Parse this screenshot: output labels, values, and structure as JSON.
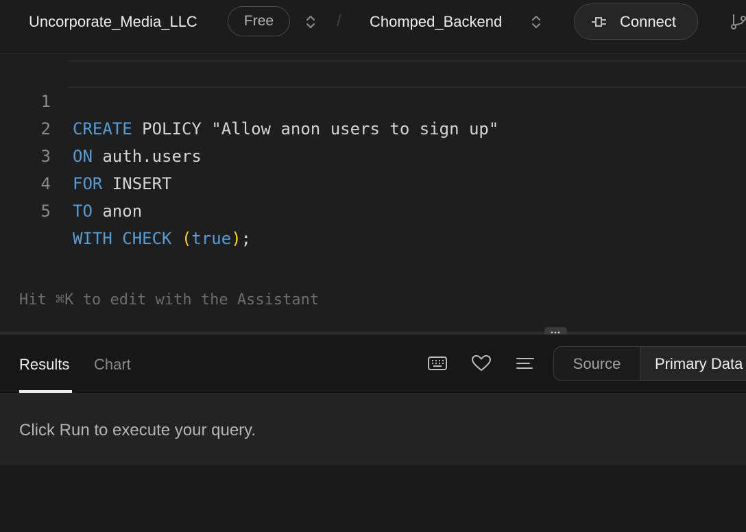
{
  "topbar": {
    "org_name": "Uncorporate_Media_LLC",
    "plan": "Free",
    "separator": "/",
    "project_name": "Chomped_Backend",
    "connect_label": "Connect"
  },
  "editor": {
    "lines": [
      {
        "num": "1"
      },
      {
        "num": "2"
      },
      {
        "num": "3"
      },
      {
        "num": "4"
      },
      {
        "num": "5"
      }
    ],
    "code": {
      "l1_kw": "CREATE",
      "l1_rest": " POLICY \"Allow anon users to sign up\"",
      "l2_kw": "ON",
      "l2_rest": " auth.users",
      "l3_kw": "FOR",
      "l3_rest": " INSERT",
      "l4_kw": "TO",
      "l4_rest": " anon",
      "l5_kw1": "WITH",
      "l5_sp": " ",
      "l5_kw2": "CHECK",
      "l5_sp2": " ",
      "l5_open": "(",
      "l5_val": "true",
      "l5_close": ")",
      "l5_end": ";"
    },
    "hint": "Hit ⌘K to edit with the Assistant"
  },
  "results": {
    "tabs": [
      "Results",
      "Chart"
    ],
    "active_tab": "Results",
    "source_label": "Source",
    "primary_label": "Primary Data",
    "empty_prefix": "Click ",
    "empty_run": "Run",
    "empty_suffix": " to execute your query."
  },
  "colors": {
    "keyword": "#569cd6",
    "paren": "#ffd700",
    "background": "#1c1c1c"
  },
  "icons": [
    "chevron-updown-icon",
    "plug-icon",
    "git-branch-icon",
    "keyboard-icon",
    "heart-icon",
    "align-left-icon",
    "drag-handle-icon"
  ]
}
